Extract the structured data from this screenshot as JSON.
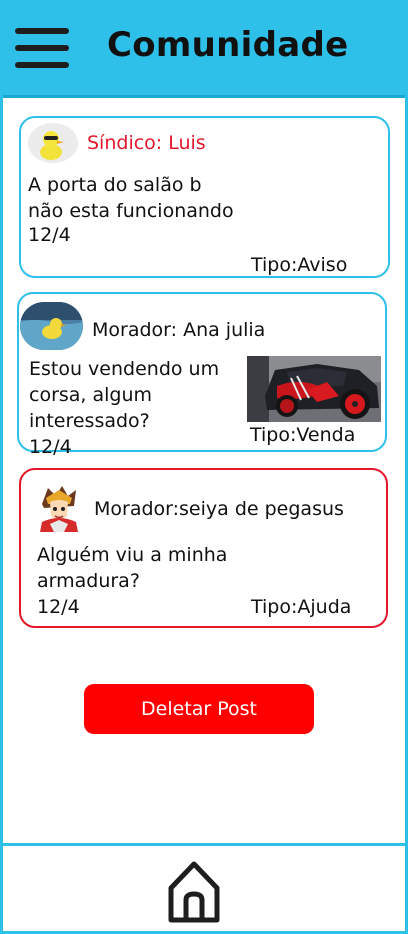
{
  "header": {
    "title": "Comunidade",
    "menu_icon": "hamburger-menu-icon"
  },
  "posts": [
    {
      "author": "Síndico: Luis",
      "message_lines": [
        "A porta do salão b",
        "não esta funcionando"
      ],
      "date": "12/4",
      "tipo": "Tipo:Aviso",
      "border_color": "#2ec0e8"
    },
    {
      "author": "Morador: Ana julia",
      "message_lines": [
        "Estou vendendo um",
        "corsa, algum",
        "interessado?"
      ],
      "date": "12/4",
      "tipo": "Tipo:Venda",
      "border_color": "#2ec0e8"
    },
    {
      "author": "Morador:seiya de pegasus",
      "message_lines": [
        "Alguém viu a minha",
        "armadura?"
      ],
      "date": "12/4",
      "tipo": "Tipo:Ajuda",
      "border_color": "#e4162c"
    }
  ],
  "actions": {
    "delete_label": "Deletar Post"
  },
  "footer": {
    "home_icon": "home-icon"
  },
  "colors": {
    "accent": "#2ec0e8",
    "danger": "#ff0000",
    "sindico_name": "#e2172c"
  }
}
